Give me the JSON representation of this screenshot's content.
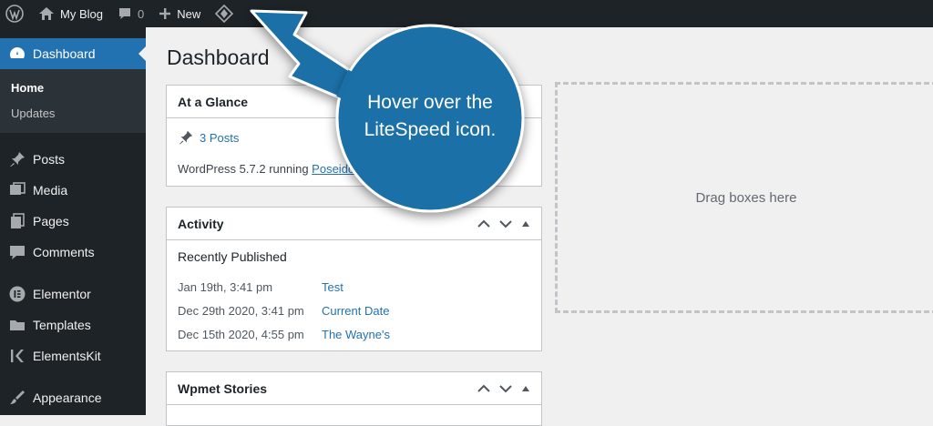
{
  "adminbar": {
    "site_name": "My Blog",
    "comments_count": "0",
    "new_label": "New"
  },
  "sidebar": {
    "dashboard_label": "Dashboard",
    "sub": [
      {
        "label": "Home"
      },
      {
        "label": "Updates"
      }
    ],
    "items": [
      {
        "label": "Posts",
        "icon": "pin-icon"
      },
      {
        "label": "Media",
        "icon": "media-icon"
      },
      {
        "label": "Pages",
        "icon": "pages-icon"
      },
      {
        "label": "Comments",
        "icon": "comment-icon"
      },
      {
        "label": "Elementor",
        "icon": "elementor-icon"
      },
      {
        "label": "Templates",
        "icon": "folder-icon"
      },
      {
        "label": "ElementsKit",
        "icon": "elementskit-icon"
      },
      {
        "label": "Appearance",
        "icon": "brush-icon"
      }
    ]
  },
  "main": {
    "title": "Dashboard",
    "glance": {
      "title": "At a Glance",
      "posts": "3 Posts",
      "version_text": "WordPress 5.7.2 running ",
      "theme_link": "Poseido"
    },
    "activity": {
      "title": "Activity",
      "heading": "Recently Published",
      "rows": [
        {
          "date": "Jan 19th, 3:41 pm",
          "title": "Test"
        },
        {
          "date": "Dec 29th 2020, 3:41 pm",
          "title": "Current Date"
        },
        {
          "date": "Dec 15th 2020, 4:55 pm",
          "title": "The Wayne's"
        }
      ]
    },
    "wpmet": {
      "title": "Wpmet Stories"
    },
    "dropzone": "Drag boxes here"
  },
  "callout": {
    "line1": "Hover over the",
    "line2": "LiteSpeed icon.",
    "color": "#1a6fa8"
  }
}
